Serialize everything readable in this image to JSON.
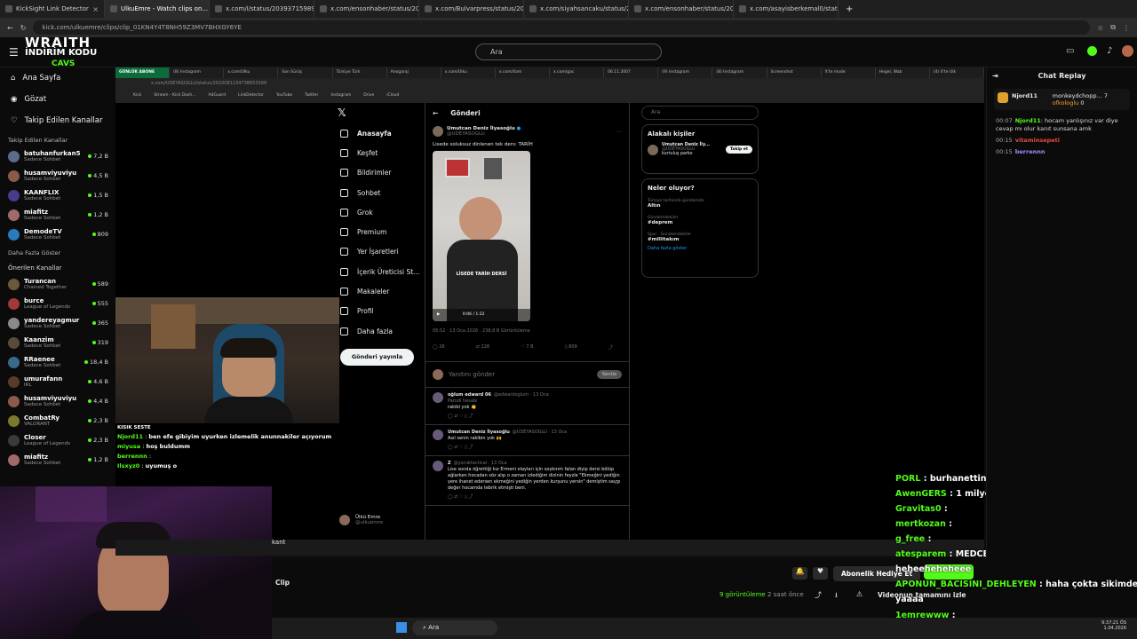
{
  "browser": {
    "tabs": [
      "KickSight Link Detector",
      "UlkuEmre - Watch clips on...",
      "x.com/i/status/2039371598917...",
      "x.com/ensonhaber/status/203...",
      "x.com/Bulvarpress/status/203...",
      "x.com/siyahsancaku/status/20...",
      "x.com/ensonhaber/status/203...",
      "x.com/asayisberkemal0/status/..."
    ],
    "url": "kick.com/ulkuemre/clips/clip_01KN4Y4T8NH59Z3MV7BHXGY6YE"
  },
  "promo": {
    "line1": "WRAITH",
    "line2": "İNDİRİM KODU",
    "line3": "CAVS"
  },
  "kick": {
    "search_placeholder": "Ara",
    "nav": [
      "Ana Sayfa",
      "Gözat",
      "Takip Edilen Kanallar"
    ],
    "followed_title": "Takip Edilen Kanallar",
    "followed": [
      {
        "name": "batuhanfurkan5",
        "cat": "Sadece Sohbet",
        "v": "7,2 B",
        "c": "#5b6b8a"
      },
      {
        "name": "husamviyuviyu",
        "cat": "Sadece Sohbet",
        "v": "4,5 B",
        "c": "#8a5b4a"
      },
      {
        "name": "KAANFLIX",
        "cat": "Sadece Sohbet",
        "v": "1,5 B",
        "c": "#4a3a8a"
      },
      {
        "name": "miafitz",
        "cat": "Sadece Sohbet",
        "v": "1,2 B",
        "c": "#a06a6a"
      },
      {
        "name": "DemodeTV",
        "cat": "Sadece Sohbet",
        "v": "809",
        "c": "#2a7ac0"
      }
    ],
    "show_more": "Daha Fazla Göster",
    "rec_title": "Önerilen Kanallar",
    "recommended": [
      {
        "name": "Turancan",
        "cat": "Chained Together",
        "v": "589",
        "c": "#6a5a3a"
      },
      {
        "name": "burce",
        "cat": "League of Legends",
        "v": "555",
        "c": "#a03a3a"
      },
      {
        "name": "yandereyagmur",
        "cat": "Sadece Sohbet",
        "v": "365",
        "c": "#8a8a8a"
      },
      {
        "name": "Kaanzim",
        "cat": "Sadece Sohbet",
        "v": "319",
        "c": "#5a4a3a"
      },
      {
        "name": "RRaenee",
        "cat": "Sadece Sohbet",
        "v": "18,4 B",
        "c": "#3a6a8a"
      },
      {
        "name": "umurafann",
        "cat": "IRL",
        "v": "4,6 B",
        "c": "#5a3a2a"
      },
      {
        "name": "husamviyuviyu",
        "cat": "Sadece Sohbet",
        "v": "4,4 B",
        "c": "#8a5b4a"
      },
      {
        "name": "CombatRy",
        "cat": "VALORANT",
        "v": "2,3 B",
        "c": "#7a7a2a"
      },
      {
        "name": "Closer",
        "cat": "League of Legends",
        "v": "2,3 B",
        "c": "#3a3a3a"
      },
      {
        "name": "miafitz",
        "cat": "Sadece Sohbet",
        "v": "1,2 B",
        "c": "#a06a6a"
      }
    ]
  },
  "inner": {
    "tabs": [
      "GÜNLÜK ABONE",
      "(8) Instagram",
      "x.com/Ulku",
      "Son Sürüş",
      "Türkiye Türk",
      "Anogaraj",
      "x.com/Ulku",
      "x.com/Xam",
      "x.com/gac",
      "06.11.2007",
      "(9) Instagram",
      "(8) Instagram",
      "Screenshot",
      "X'te mode",
      "Hegel, Wab",
      "(4) X'te Ulk"
    ],
    "url": "x.com/UDEYASOGLU/status/2010081134738653599",
    "bookmarks": [
      "Kick",
      "Stream - Kick Dash...",
      "AdGuard",
      "LinkDetector",
      "YouTube",
      "Twitter",
      "Instagram",
      "Drive",
      "iCloud"
    ]
  },
  "x": {
    "nav": [
      "Anasayfa",
      "Keşfet",
      "Bildirimler",
      "Sohbet",
      "Grok",
      "Premium",
      "Yer İşaretleri",
      "İçerik Üreticisi St...",
      "Makaleler",
      "Profil",
      "Daha fazla"
    ],
    "post_button": "Gönderi yayınla",
    "profile_name": "Ülkü Emre",
    "profile_handle": "@ulkuemre",
    "header": "Gönderi",
    "author": "Umutcan Deniz İlyasoğlu",
    "handle": "@UDEYASOGLU",
    "text": "Lisede soluksuz dinlenen tek ders: TARİH",
    "video_caption": "LİSEDE TARİH DERSİ",
    "video_time": "0:06 / 1:22",
    "meta": "05:52 · 13 Oca 2026 · 238,8 B Görüntüleme",
    "stats": [
      "28",
      "228",
      "7 B",
      "809"
    ],
    "reply_placeholder": "Yanıtını gönder",
    "reply_btn": "Yanıtla",
    "search": "Ara",
    "relevant": "Alakalı kişiler",
    "rel_name": "Umutcan Deniz İly...",
    "rel_handle": "@UDEYASOGLU",
    "rel_bio": "kurtuluş parko",
    "follow": "Takip et",
    "whats": "Neler oluyor?",
    "trends": [
      {
        "cat": "Türkiye tarihinde gündemde",
        "tag": "Altın"
      },
      {
        "cat": "Gündemdekiler",
        "tag": "#deprem"
      },
      {
        "cat": "Spor · Gündemdekiler",
        "tag": "#millitakım"
      }
    ],
    "more": "Daha fazla göster",
    "replies": [
      {
        "name": "oğlum edward 06",
        "handle": "@edwardogium · 13 Oca",
        "sub": "Parodi hesabı",
        "text": "rakibi yok 👏"
      },
      {
        "name": "Umutcan Deniz İlyasoğlu",
        "handle": "@UDEYASOGLU · 13 Oca",
        "sub": "",
        "text": "Asıl senin rakibin yok 🙌"
      },
      {
        "name": "Z",
        "handle": "@yoruktactical · 13 Oca",
        "sub": "",
        "text": "Lise sonda öğrettiği kız Ermeni olayları için soykırım falan diyip dersi bölüp ağlarken hocadan söz alıp o zaman izlediğim dizinin feyzle \"Ekmeğini yediğin yere ihanet edersen ekmeğini yediğin yerden kurşunu yersin\" demiştim saygı değer hocamda tebrik etmişti beni."
      }
    ]
  },
  "stream_chat": {
    "title": "KISIK SESTE",
    "lines": [
      {
        "u": "Njord11",
        "t": "ben efe gibiyim uyurken izlemelik anunnakiler açıyorum"
      },
      {
        "u": "miyusa",
        "t": "hoş buldumm"
      },
      {
        "u": "berrennn",
        "t": ""
      },
      {
        "u": "Ilsxyz0",
        "t": "uyumuş o"
      }
    ]
  },
  "overlay_chat": [
    {
      "u": "PORL",
      "t": "burhanettin"
    },
    {
      "u": "AwenGERS",
      "t": "1 milyonluk araba"
    },
    {
      "u": "Gravitas0",
      "t": ""
    },
    {
      "u": "mertkozan",
      "t": ""
    },
    {
      "u": "g_free",
      "t": ""
    },
    {
      "u": "atesparem",
      "t": "MEDCEZİR İZLEYELİM"
    },
    {
      "u": "",
      "t": "heheeheheheee"
    },
    {
      "u": "APONUN_BACISINI_DEHLEYEN",
      "t": "haha çokta sikimdeydi"
    },
    {
      "u": "",
      "t": "yaaaa"
    },
    {
      "u": "1emrewww",
      "t": ""
    },
    {
      "u": "h2ktan",
      "t": "arac otopilotta mıydı"
    }
  ],
  "clip": {
    "label": "Clip",
    "kant": "kant",
    "views": "9 görüntüleme",
    "ago": "2 saat önce",
    "sub_btn": "Abonelik Hediye Et",
    "full": "Videonun tamamını izle"
  },
  "replay": {
    "title": "Chat Replay",
    "pinned_user": "Njord11",
    "pinned_count": "7",
    "pin2": "monkeydchopp...",
    "pin3": "ofkologlu",
    "pin_count2": "0",
    "lines": [
      {
        "ts": "00:07",
        "u": "Njord11",
        "t": "hocam yanlışınız var diye cevap mı olur kanıt sunsana amk"
      },
      {
        "ts": "00:15",
        "u": "vitaminsepeti",
        "t": ""
      },
      {
        "ts": "00:15",
        "u": "berrennn",
        "t": ""
      }
    ]
  },
  "taskbar": {
    "search": "Ara",
    "time": "9:37:21 ÖS",
    "date": "1.04.2026"
  }
}
